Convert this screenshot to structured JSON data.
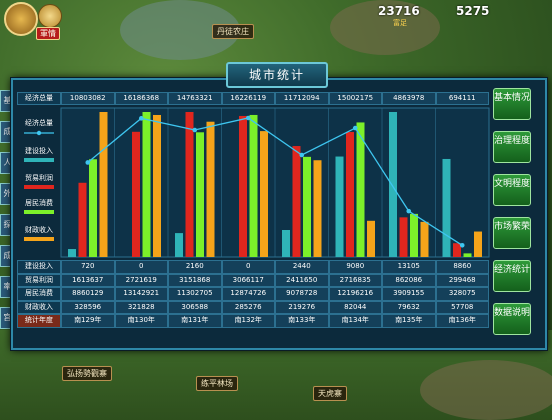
{
  "topbar": {
    "avatar_badge": "軍情",
    "resource_1": "23716",
    "resource_1_sub": "富足",
    "resource_2": "5275"
  },
  "map_labels": [
    "丹徒农庄",
    "弘扬勢觀寨",
    "练平林场",
    "天虎寨"
  ],
  "left_tabs": [
    "基",
    "成",
    "人",
    "外",
    "探",
    "成",
    "率",
    "宫"
  ],
  "panel": {
    "title": "城市统计",
    "legend": [
      "经济总量",
      "建设投入",
      "贸易利润",
      "居民消费",
      "财政收入"
    ],
    "right_buttons": [
      "基本情况",
      "治理程度",
      "文明程度",
      "市场繁荣",
      "经济统计",
      "数据说明"
    ]
  },
  "table": {
    "row_labels": [
      "建设投入",
      "贸易利润",
      "居民消费",
      "财政收入",
      "统计年度"
    ],
    "top_label": "经济总量",
    "top_values": [
      "10803082",
      "16186368",
      "14763321",
      "16226119",
      "11712094",
      "15002175",
      "4863978",
      "694111"
    ],
    "rows": [
      [
        "720",
        "0",
        "2160",
        "0",
        "2440",
        "9080",
        "13105",
        "8860"
      ],
      [
        "1613637",
        "2721619",
        "3151868",
        "3066117",
        "2411650",
        "2716835",
        "862086",
        "299468"
      ],
      [
        "8860129",
        "13142921",
        "11302705",
        "12874726",
        "9078728",
        "12196216",
        "3909155",
        "328075"
      ],
      [
        "328596",
        "321828",
        "306588",
        "285276",
        "219276",
        "82044",
        "79632",
        "57708"
      ],
      [
        "南129年",
        "南130年",
        "南131年",
        "南132年",
        "南133年",
        "南134年",
        "南135年",
        "南136年"
      ]
    ]
  },
  "chart_data": {
    "type": "bar",
    "categories": [
      "南129年",
      "南130年",
      "南131年",
      "南132年",
      "南133年",
      "南134年",
      "南135年",
      "南136年"
    ],
    "series": [
      {
        "name": "建设投入",
        "values": [
          720,
          0,
          2160,
          0,
          2440,
          9080,
          13105,
          8860
        ]
      },
      {
        "name": "贸易利润",
        "values": [
          1613637,
          2721619,
          3151868,
          3066117,
          2411650,
          2716835,
          862086,
          299468
        ]
      },
      {
        "name": "居民消费",
        "values": [
          8860129,
          13142921,
          11302705,
          12874726,
          9078728,
          12196216,
          3909155,
          328075
        ]
      },
      {
        "name": "财政收入",
        "values": [
          328596,
          321828,
          306588,
          285276,
          219276,
          82044,
          79632,
          57708
        ]
      },
      {
        "name": "经济总量",
        "type": "line",
        "values": [
          10803082,
          16186368,
          14763321,
          16226119,
          11712094,
          15002175,
          4863978,
          694111
        ]
      }
    ],
    "colors": {
      "建设投入": "#2fb4b8",
      "贸易利润": "#e0261e",
      "居民消费": "#7cf02a",
      "财政收入": "#f5a41a",
      "经济总量": "#3ec6f0"
    }
  }
}
